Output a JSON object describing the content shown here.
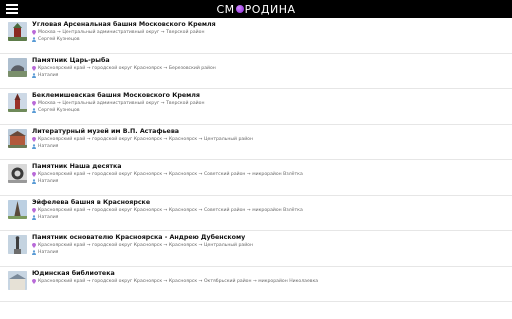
{
  "app": {
    "brand_left": "СМ",
    "brand_right": "РОДИНА"
  },
  "items": [
    {
      "title": "Угловая Арсенальная башня Московского Кремля",
      "location": "Москва → Центральный административный округ → Тверской район",
      "author": "Сергей Кузнецов"
    },
    {
      "title": "Памятник Царь-рыба",
      "location": "Красноярский край → городской округ Красноярск → Березовский район",
      "author": "Наталия"
    },
    {
      "title": "Беклемишевская башня Московского Кремля",
      "location": "Москва → Центральный административный округ → Тверской район",
      "author": "Сергей Кузнецов"
    },
    {
      "title": "Литературный музей им В.П. Астафьева",
      "location": "Красноярский край → городской округ Красноярск → Красноярск → Центральный район",
      "author": "Наталия"
    },
    {
      "title": "Памятник Наша десятка",
      "location": "Красноярский край → городской округ Красноярск → Красноярск → Советский район → микрорайон Взлётка",
      "author": "Наталия"
    },
    {
      "title": "Эйфелева башня в Красноярске",
      "location": "Красноярский край → городской округ Красноярск → Красноярск → Советский район → микрорайон Взлётка",
      "author": "Наталия"
    },
    {
      "title": "Памятник основателю Красноярска - Андрею Дубенскому",
      "location": "Красноярский край → городской округ Красноярск → Красноярск → Центральный район",
      "author": "Наталия"
    },
    {
      "title": "Юдинская библиотека",
      "location": "Красноярский край → городской округ Красноярск → Красноярск → Октябрьский район → микрорайон Николаевка",
      "author": ""
    }
  ],
  "colors": {
    "topbar": "#000000",
    "brand_dot": "#a340ef",
    "pin": "#b96ad8",
    "person": "#5a9bd5"
  },
  "icons": {
    "menu": "hamburger-icon",
    "location": "location-pin-icon",
    "author": "person-icon"
  }
}
